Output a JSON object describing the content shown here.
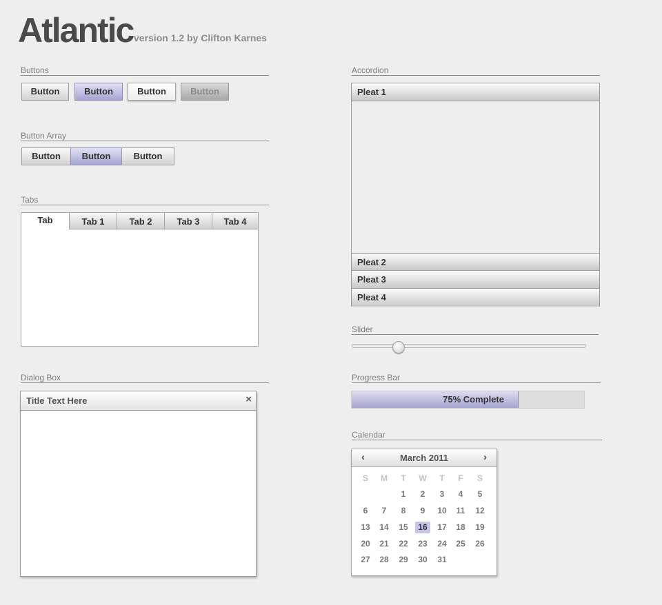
{
  "header": {
    "title": "Atlantic",
    "subtitle": "version 1.2 by Clifton Karnes"
  },
  "sections": {
    "buttons": "Buttons",
    "button_array": "Button Array",
    "tabs": "Tabs",
    "dialog": "Dialog Box",
    "accordion": "Accordion",
    "slider": "Slider",
    "progress": "Progress Bar",
    "calendar": "Calendar"
  },
  "buttons": [
    {
      "label": "Button",
      "state": "normal"
    },
    {
      "label": "Button",
      "state": "pressed-blue"
    },
    {
      "label": "Button",
      "state": "focused"
    },
    {
      "label": "Button",
      "state": "disabled"
    }
  ],
  "button_array": [
    {
      "label": "Button"
    },
    {
      "label": "Button",
      "selected": true
    },
    {
      "label": "Button"
    }
  ],
  "tabs": [
    {
      "label": "Tab",
      "active": true
    },
    {
      "label": "Tab 1"
    },
    {
      "label": "Tab 2"
    },
    {
      "label": "Tab 3"
    },
    {
      "label": "Tab 4"
    }
  ],
  "dialog": {
    "title": "Title Text Here",
    "close_icon": "close-icon",
    "close_glyph": "×"
  },
  "accordion": {
    "pleats": [
      {
        "label": "Pleat 1",
        "expanded": true
      },
      {
        "label": "Pleat 2"
      },
      {
        "label": "Pleat 3"
      },
      {
        "label": "Pleat 4"
      }
    ]
  },
  "slider": {
    "value_fraction": 0.2
  },
  "progress": {
    "percent": 75,
    "label": "75% Complete"
  },
  "calendar": {
    "month": "March 2011",
    "prev_glyph": "‹",
    "next_glyph": "›",
    "weekdays": [
      "S",
      "M",
      "T",
      "W",
      "T",
      "F",
      "S"
    ],
    "first_weekday_index": 2,
    "days_in_month": 31,
    "selected_day": 16
  },
  "colors": {
    "accent": "#a4a4d2",
    "background": "#eeeeee"
  }
}
